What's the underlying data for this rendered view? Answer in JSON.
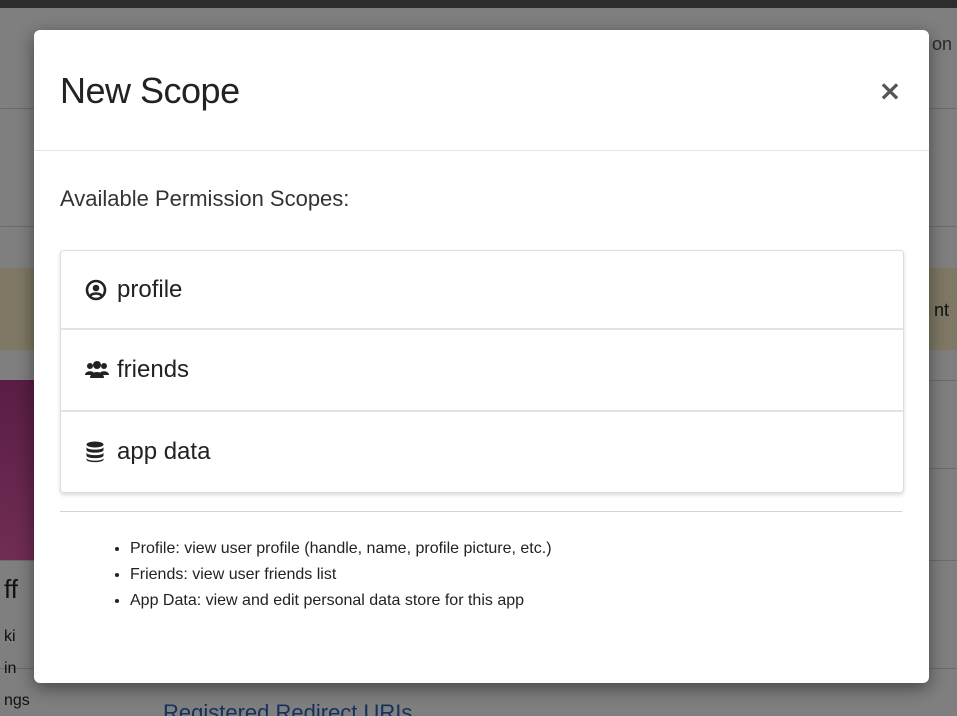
{
  "modal": {
    "title": "New Scope",
    "close_symbol": "×",
    "section_label": "Available Permission Scopes:",
    "scopes": [
      {
        "label": "profile",
        "icon": "user-circle-icon"
      },
      {
        "label": "friends",
        "icon": "users-group-icon"
      },
      {
        "label": "app data",
        "icon": "database-icon"
      }
    ],
    "descriptions": [
      "Profile: view user profile (handle, name, profile picture, etc.)",
      "Friends: view user friends list",
      "App Data: view and edit personal data store for this app"
    ]
  },
  "background": {
    "partial_texts": [
      "on",
      "nt",
      "ff",
      "ki",
      "in",
      "ngs"
    ],
    "link_text": "Registered Redirect URIs"
  },
  "colors": {
    "overlay": "rgba(0,0,0,0.5)",
    "warning_band": "#fcf0c8",
    "link": "#2a63b8"
  }
}
